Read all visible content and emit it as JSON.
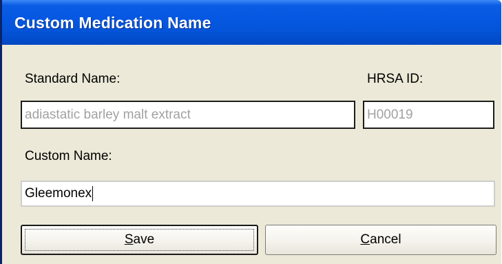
{
  "window": {
    "title": "Custom Medication Name"
  },
  "form": {
    "standard_name_label": "Standard Name:",
    "standard_name_value": "adiastatic barley malt extract",
    "hrsa_id_label": "HRSA ID:",
    "hrsa_id_value": "H00019",
    "custom_name_label": "Custom Name:",
    "custom_name_value": "Gleemonex"
  },
  "buttons": {
    "save_mnemonic": "S",
    "save_rest": "ave",
    "cancel_mnemonic": "C",
    "cancel_rest": "ancel"
  },
  "colors": {
    "titlebar": "#0354d8",
    "dialog_bg": "#ece9d8",
    "readonly_text": "#a1a1a1"
  }
}
